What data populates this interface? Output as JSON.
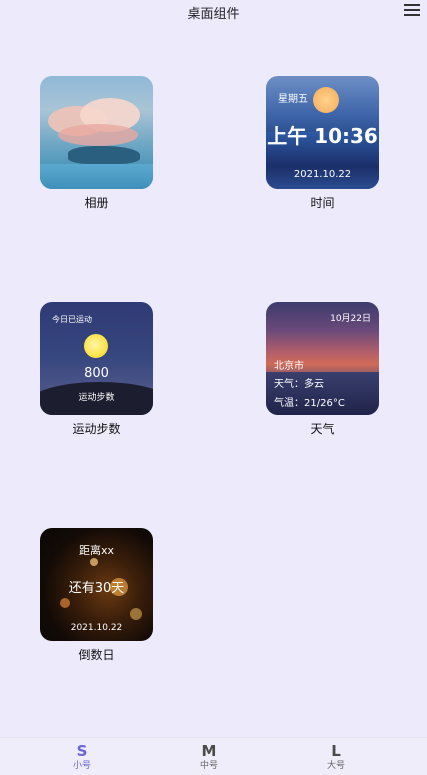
{
  "header": {
    "title": "桌面组件",
    "menu_icon": "menu-icon"
  },
  "widgets": {
    "album": {
      "caption": "相册"
    },
    "time": {
      "weekday": "星期五",
      "clock": "上午 10:36",
      "date": "2021.10.22",
      "caption": "时间"
    },
    "steps": {
      "today": "今日已运动",
      "count": "800",
      "label": "运动步数",
      "caption": "运动步数"
    },
    "weather": {
      "date": "10月22日",
      "city": "北京市",
      "condition": "天气：多云",
      "temp": "气温：21/26°C",
      "caption": "天气"
    },
    "countdown": {
      "title": "距离xx",
      "remaining": "还有30天",
      "date": "2021.10.22",
      "caption": "倒数日"
    }
  },
  "tabs": [
    {
      "symbol": "S",
      "label": "小号",
      "active": true
    },
    {
      "symbol": "M",
      "label": "中号",
      "active": false
    },
    {
      "symbol": "L",
      "label": "大号",
      "active": false
    }
  ],
  "colors": {
    "background": "#eceafb",
    "accent": "#6b63d6"
  }
}
